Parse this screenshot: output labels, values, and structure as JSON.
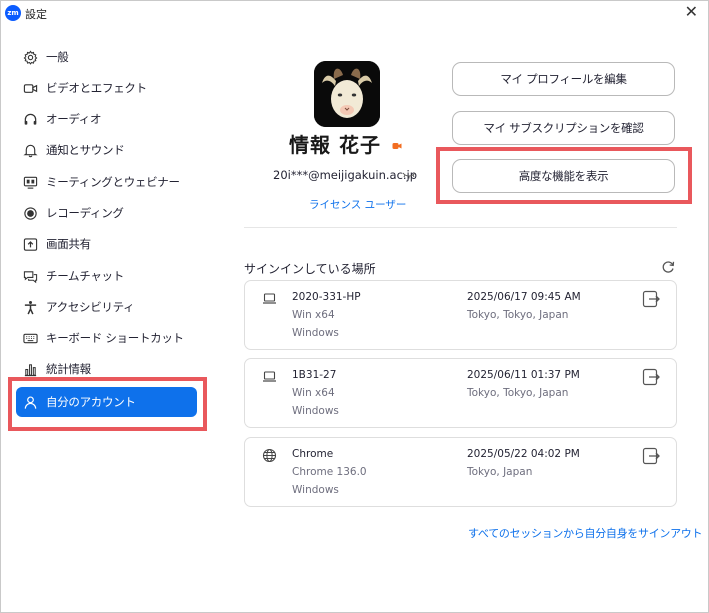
{
  "window": {
    "app_logo": "zm",
    "title": "設定",
    "close_glyph": "✕"
  },
  "sidebar": {
    "items": [
      {
        "label": "一般",
        "icon": "gear-icon"
      },
      {
        "label": "ビデオとエフェクト",
        "icon": "video-icon"
      },
      {
        "label": "オーディオ",
        "icon": "headphones-icon"
      },
      {
        "label": "通知とサウンド",
        "icon": "bell-icon"
      },
      {
        "label": "ミーティングとウェビナー",
        "icon": "meeting-icon"
      },
      {
        "label": "レコーディング",
        "icon": "record-icon"
      },
      {
        "label": "画面共有",
        "icon": "share-screen-icon"
      },
      {
        "label": "チームチャット",
        "icon": "chat-icon"
      },
      {
        "label": "アクセシビリティ",
        "icon": "accessibility-icon"
      },
      {
        "label": "キーボード ショートカット",
        "icon": "keyboard-icon"
      },
      {
        "label": "統計情報",
        "icon": "stats-icon"
      },
      {
        "label": "自分のアカウント",
        "icon": "user-icon"
      }
    ],
    "active_index": 11
  },
  "profile": {
    "name": "情報 花子",
    "email": "20i***@meijigakuin.ac.jp",
    "license": "ライセンス ユーザー",
    "status_color": "#f26d21"
  },
  "actions": {
    "edit_profile": "マイ プロフィールを編集",
    "subscription": "マイ サブスクリプションを確認",
    "advanced": "高度な機能を表示"
  },
  "sessions": {
    "title": "サインインしている場所",
    "items": [
      {
        "device": "2020-331-HP",
        "os": "Win x64",
        "platform": "Windows",
        "date": "2025/06/17 09:45 AM",
        "location": "Tokyo, Tokyo, Japan",
        "icon": "laptop-icon"
      },
      {
        "device": "1B31-27",
        "os": "Win x64",
        "platform": "Windows",
        "date": "2025/06/11 01:37 PM",
        "location": "Tokyo, Tokyo, Japan",
        "icon": "laptop-icon"
      },
      {
        "device": "Chrome",
        "os": "Chrome 136.0",
        "platform": "Windows",
        "date": "2025/05/22 04:02 PM",
        "location": "Tokyo, Japan",
        "icon": "globe-icon"
      }
    ],
    "signout_all": "すべてのセッションから自分自身をサインアウト"
  },
  "colors": {
    "accent": "#0e71eb",
    "highlight": "#e9585c"
  }
}
